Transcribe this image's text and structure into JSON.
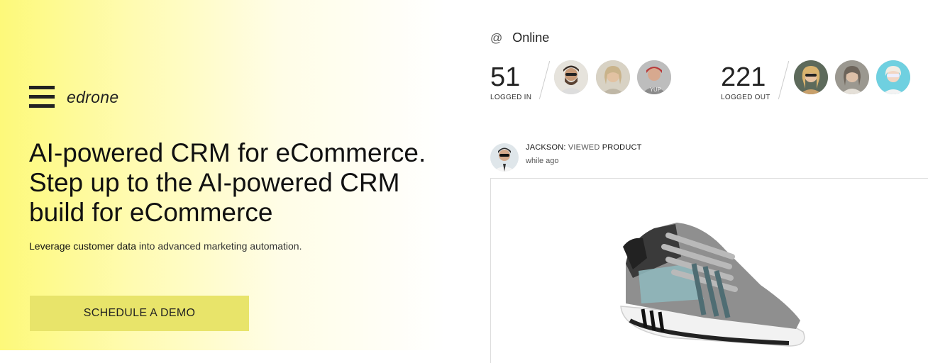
{
  "brand": {
    "name": "edrone",
    "menu_icon": "hamburger-menu-icon"
  },
  "hero": {
    "headline_line1": "AI-powered CRM for eCommerce.",
    "headline_line2": "Step up to the AI-powered CRM",
    "headline_line3": "build for eCommerce",
    "sub_bold": "Leverage customer data",
    "sub_rest": " into advanced marketing automation.",
    "cta_label": "SCHEDULE A DEMO"
  },
  "online_panel": {
    "at_symbol": "@",
    "title": "Online",
    "logged_in": {
      "count": "51",
      "label": "LOGGED IN"
    },
    "logged_out": {
      "count": "221",
      "label": "LOGGED OUT"
    }
  },
  "feed": {
    "user": "JACKSON",
    "separator": ":",
    "action": " VIEWED",
    "object": " PRODUCT",
    "time": "while ago",
    "product_image": "sneaker-image"
  },
  "colors": {
    "accent_yellow": "#fdf97a",
    "cta_bg": "#e8e46a",
    "text": "#222222"
  }
}
